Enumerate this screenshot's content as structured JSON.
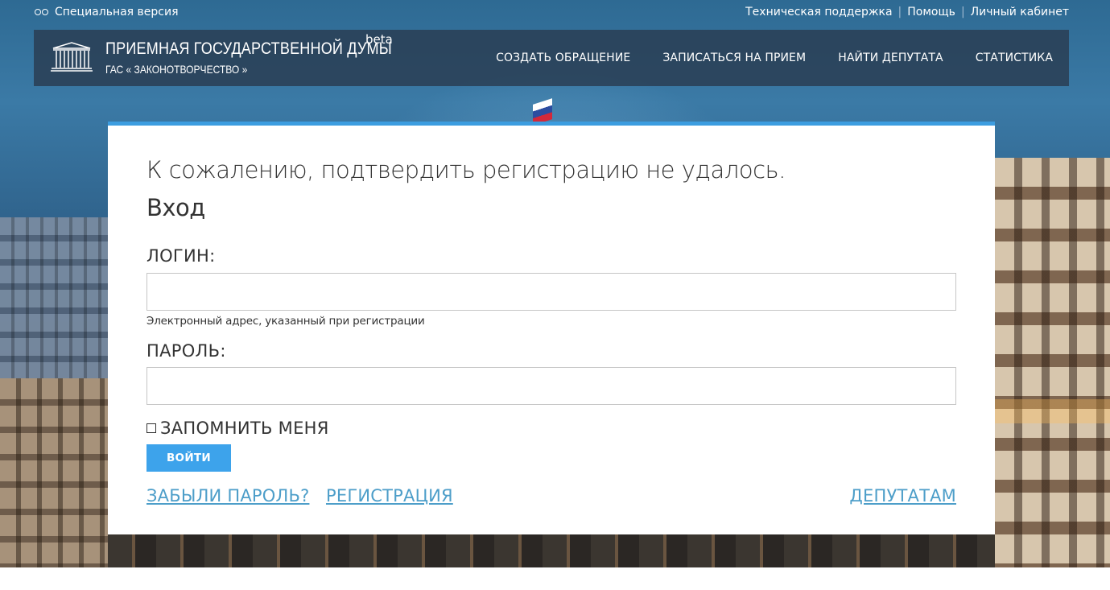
{
  "topbar": {
    "special_version": "Специальная версия",
    "links": [
      "Техническая поддержка",
      "Помощь",
      "Личный кабинет"
    ],
    "separator": "|"
  },
  "header": {
    "logo_title": "ПРИЕМНАЯ ГОСУДАРСТВЕННОЙ ДУМЫ",
    "logo_subtitle": "ГАС « ЗАКОНОТВОРЧЕСТВО »",
    "beta": "beta",
    "nav": [
      "СОЗДАТЬ ОБРАЩЕНИЕ",
      "ЗАПИСАТЬСЯ НА ПРИЕМ",
      "НАЙТИ ДЕПУТАТА",
      "СТАТИСТИКА"
    ]
  },
  "form": {
    "error_message": "К сожалению, подтвердить регистрацию не удалось.",
    "title": "Вход",
    "login_label": "ЛОГИН:",
    "login_value": "",
    "login_hint": "Электронный адрес, указанный при регистрации",
    "password_label": "ПАРОЛЬ:",
    "password_value": "",
    "remember_label": "ЗАПОМНИТЬ МЕНЯ",
    "remember_checked": false,
    "submit_label": "ВОЙТИ",
    "forgot_link": "ЗАБЫЛИ ПАРОЛЬ?",
    "register_link": "РЕГИСТРАЦИЯ",
    "deputies_link": "ДЕПУТАТАМ"
  },
  "colors": {
    "accent": "#3c9de0",
    "button": "#3da3eb",
    "link": "#4d9ec9",
    "header_bg": "#2a3c50"
  },
  "icons": [
    "glasses-icon",
    "duma-building-logo-icon",
    "checkbox-icon"
  ]
}
